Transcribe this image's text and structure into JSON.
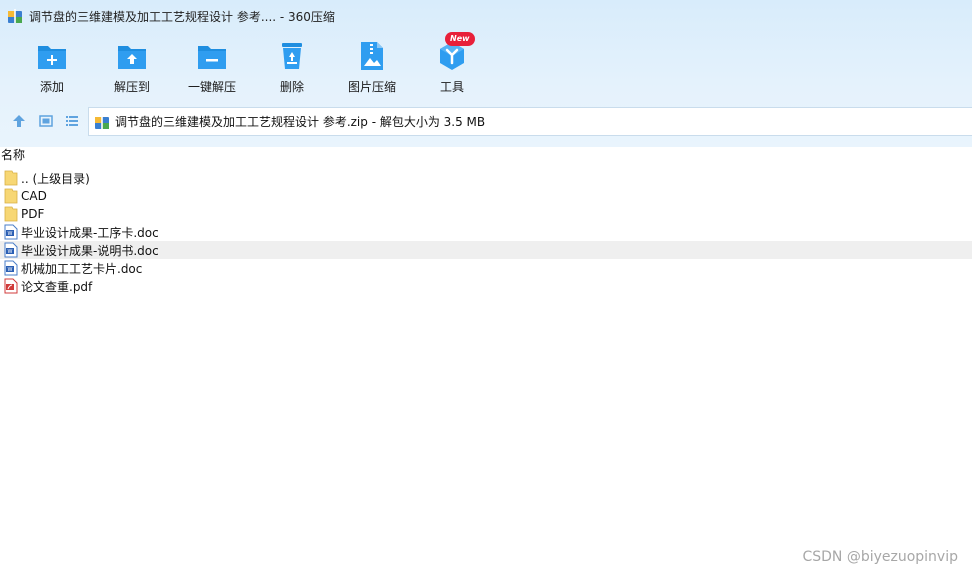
{
  "window": {
    "title": "调节盘的三维建模及加工工艺规程设计 参考.... - 360压缩"
  },
  "toolbar": {
    "add": "添加",
    "extract_to": "解压到",
    "one_click_extract": "一键解压",
    "delete": "删除",
    "image_compress": "图片压缩",
    "tools": "工具",
    "tools_badge": "New"
  },
  "pathbar": {
    "text": "调节盘的三维建模及加工工艺规程设计 参考.zip - 解包大小为 3.5 MB"
  },
  "list": {
    "column_name": "名称",
    "items": [
      {
        "name": ".. (上级目录)",
        "icon": "folder-icon"
      },
      {
        "name": "CAD",
        "icon": "folder-icon"
      },
      {
        "name": "PDF",
        "icon": "folder-icon"
      },
      {
        "name": "毕业设计成果-工序卡.doc",
        "icon": "word-doc-icon"
      },
      {
        "name": "毕业设计成果-说明书.doc",
        "icon": "word-doc-icon"
      },
      {
        "name": "机械加工工艺卡片.doc",
        "icon": "word-doc-icon"
      },
      {
        "name": "论文查重.pdf",
        "icon": "pdf-icon"
      }
    ]
  },
  "watermark": "CSDN @biyezuopinvip",
  "colors": {
    "accent": "#1f8ee0",
    "toolbar_bg": "#dcedfb",
    "hover_row": "#efefef"
  }
}
